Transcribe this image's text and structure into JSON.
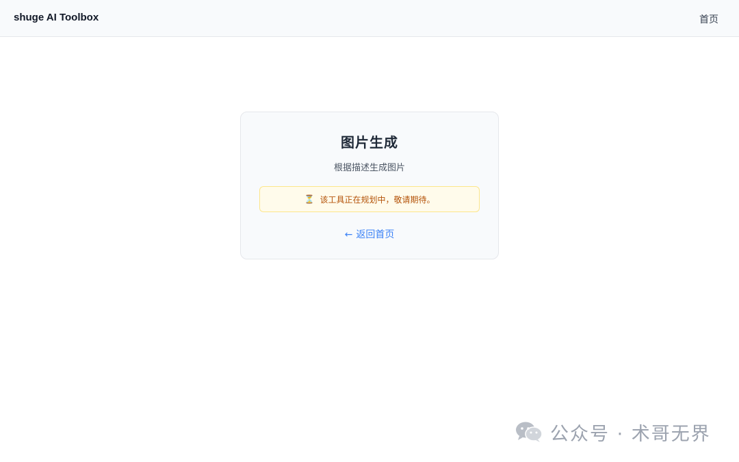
{
  "nav": {
    "brand": "shuge AI Toolbox",
    "home_link": "首页"
  },
  "card": {
    "title": "图片生成",
    "subtitle": "根据描述生成图片",
    "notice": {
      "icon": "hourglass-icon",
      "text": "该工具正在规划中，敬请期待。"
    },
    "back_link": {
      "icon": "arrow-left-icon",
      "label": "返回首页"
    }
  },
  "watermark": {
    "icon": "wechat-icon",
    "text": "公众号 · 术哥无界"
  },
  "colors": {
    "navbar_bg": "#f8fafc",
    "card_bg": "#f8fafc",
    "notice_bg": "#fffbeb",
    "notice_border": "#fde68a",
    "notice_text": "#b45309",
    "link": "#3b82f6"
  }
}
